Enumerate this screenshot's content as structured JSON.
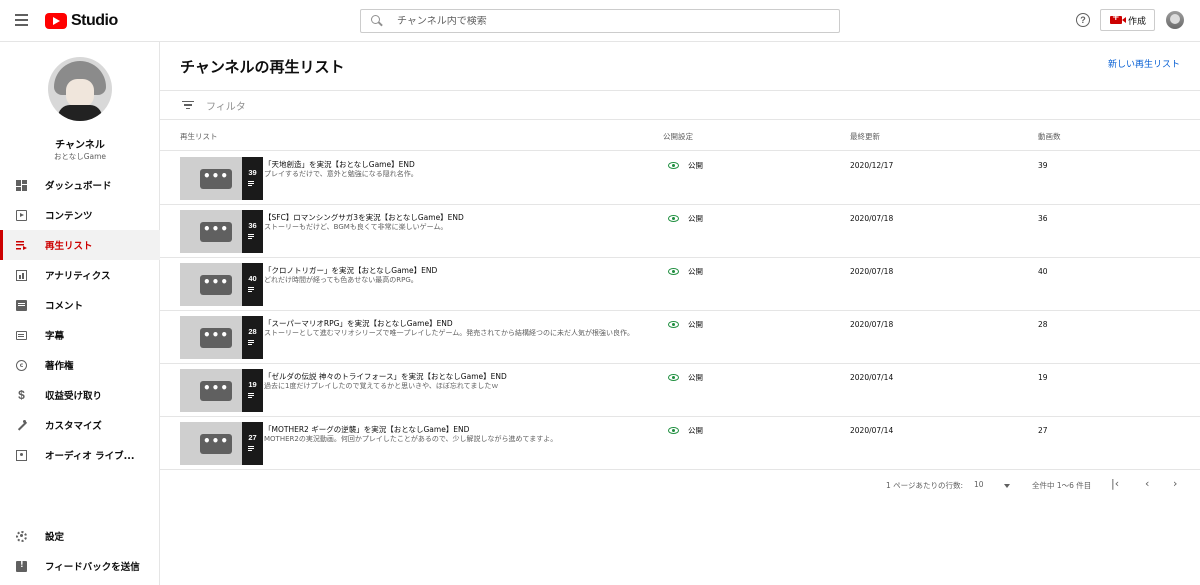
{
  "header": {
    "logo_text": "Studio",
    "search_placeholder": "チャンネル内で検索",
    "help_glyph": "?",
    "create_label": "作成"
  },
  "channel": {
    "name": "チャンネル",
    "subname": "おとなしGame"
  },
  "nav": [
    {
      "label": "ダッシュボード",
      "icon": "dashboard-icon"
    },
    {
      "label": "コンテンツ",
      "icon": "content-icon"
    },
    {
      "label": "再生リスト",
      "icon": "playlist-icon",
      "active": true
    },
    {
      "label": "アナリティクス",
      "icon": "analytics-icon"
    },
    {
      "label": "コメント",
      "icon": "comment-icon"
    },
    {
      "label": "字幕",
      "icon": "subtitles-icon"
    },
    {
      "label": "著作権",
      "icon": "copyright-icon"
    },
    {
      "label": "収益受け取り",
      "icon": "dollar-icon"
    },
    {
      "label": "カスタマイズ",
      "icon": "magic-wand-icon"
    },
    {
      "label": "オーディオ ライブ...",
      "icon": "audio-library-icon"
    }
  ],
  "nav_bottom": [
    {
      "label": "設定",
      "icon": "gear-icon"
    },
    {
      "label": "フィードバックを送信",
      "icon": "feedback-icon"
    }
  ],
  "main": {
    "title": "チャンネルの再生リスト",
    "new_playlist": "新しい再生リスト",
    "filter_label": "フィルタ",
    "columns": {
      "playlist": "再生リスト",
      "visibility": "公開設定",
      "updated": "最終更新",
      "count": "動画数"
    }
  },
  "playlists": [
    {
      "title": "「天地創造」を実況【おとなしGame】END",
      "desc": "プレイするだけで、意外と勉強になる隠れ名作。",
      "visibility": "公開",
      "date": "2020/12/17",
      "count": "39"
    },
    {
      "title": "【SFC】ロマンシングサガ3を実況【おとなしGame】END",
      "desc": "ストーリーもだけど、BGMも良くて非常に楽しいゲーム。",
      "visibility": "公開",
      "date": "2020/07/18",
      "count": "36"
    },
    {
      "title": "「クロノトリガー」を実況【おとなしGame】END",
      "desc": "どれだけ時間が経っても色あせない最高のRPG。",
      "visibility": "公開",
      "date": "2020/07/18",
      "count": "40"
    },
    {
      "title": "「スーパーマリオRPG」を実況【おとなしGame】END",
      "desc": "ストーリーとして進むマリオシリーズで唯一プレイしたゲーム。発売されてから結構経つのに未だ人気が根強い良作。",
      "visibility": "公開",
      "date": "2020/07/18",
      "count": "28"
    },
    {
      "title": "「ゼルダの伝説 神々のトライフォース」を実況【おとなしGame】END",
      "desc": "過去に1度だけプレイしたので覚えてるかと思いきや、ほぼ忘れてましたｗ",
      "visibility": "公開",
      "date": "2020/07/14",
      "count": "19"
    },
    {
      "title": "「MOTHER2 ギーグの逆襲」を実況【おとなしGame】END",
      "desc": "MOTHER2の実況動画。何回かプレイしたことがあるので、少し解説しながら進めてますよ。",
      "visibility": "公開",
      "date": "2020/07/14",
      "count": "27"
    }
  ],
  "pager": {
    "rows_label": "1 ページあたりの行数:",
    "rows_value": "10",
    "range": "全件中 1～6 件目",
    "first": "|‹",
    "prev": "‹",
    "next": "›"
  },
  "colors": {
    "accent": "#cc0000",
    "link": "#065fd4",
    "public": "#1e8e3e"
  }
}
